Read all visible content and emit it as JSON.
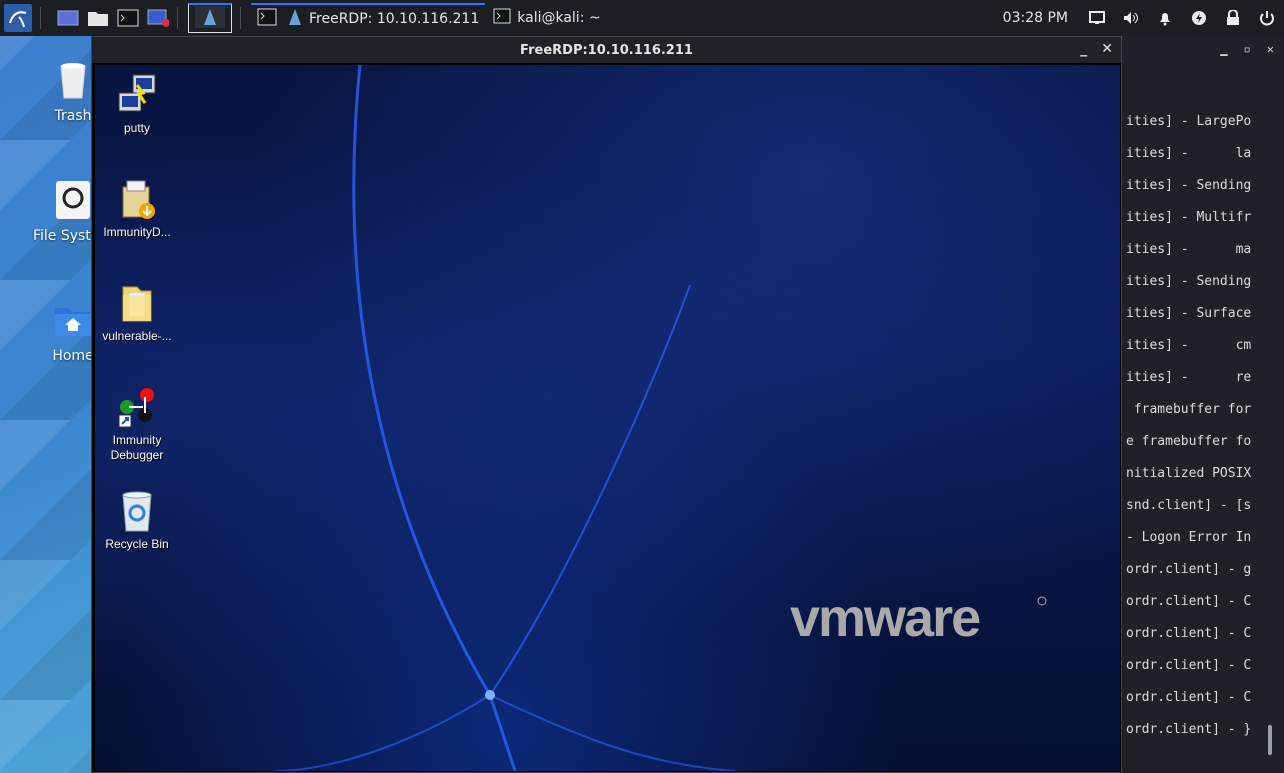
{
  "top_panel": {
    "tasks": [
      {
        "label": "FreeRDP: 10.10.116.211"
      },
      {
        "label": "kali@kali: ~"
      }
    ],
    "clock": "03:28 PM"
  },
  "kali_desktop": {
    "icons": [
      {
        "label": "Trash"
      },
      {
        "label": "File System"
      },
      {
        "label": "Home"
      }
    ]
  },
  "rdp_window": {
    "title": "FreeRDP:10.10.116.211",
    "min_glyph": "_",
    "close_glyph": "✕",
    "desktop_icons": [
      {
        "label": "putty"
      },
      {
        "label": "ImmunityD..."
      },
      {
        "label": "vulnerable-..."
      },
      {
        "label": "Immunity Debugger"
      },
      {
        "label": "Recycle Bin"
      }
    ],
    "watermark": "vmware"
  },
  "terminal": {
    "lines": [
      "ities] - LargePo",
      "ities] -      la",
      "ities] - Sending",
      "ities] - Multifr",
      "ities] -      ma",
      "ities] - Sending",
      "ities] - Surface",
      "ities] -      cm",
      "ities] -      re",
      " framebuffer for",
      "e framebuffer fo",
      "nitialized POSIX",
      "snd.client] - [s",
      "- Logon Error In",
      "ordr.client] - g",
      "ordr.client] - C",
      "ordr.client] - C",
      "ordr.client] - C",
      "ordr.client] - C",
      "ordr.client] - }"
    ]
  }
}
